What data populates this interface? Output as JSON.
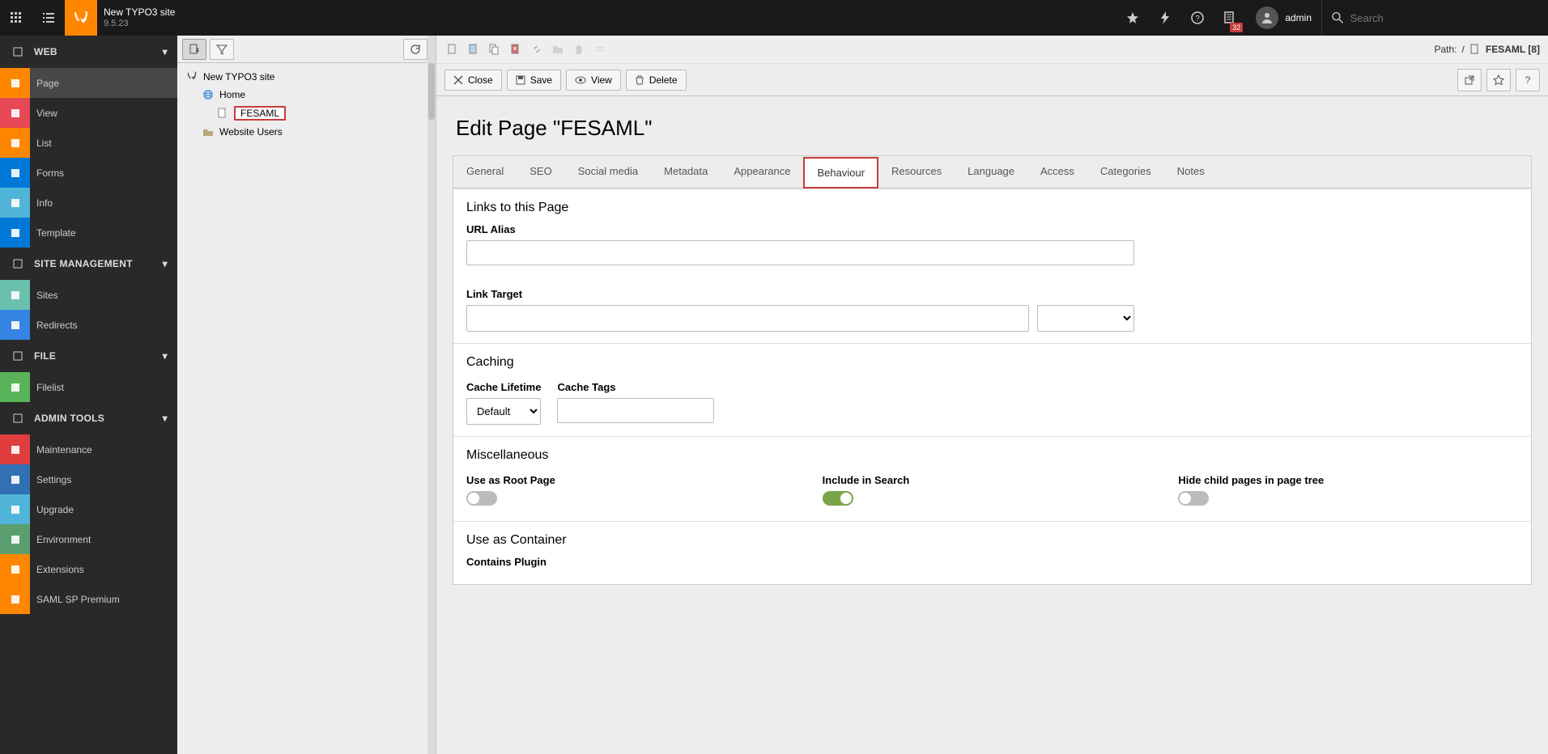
{
  "topbar": {
    "site_title": "New TYPO3 site",
    "site_version": "9.5.23",
    "badge": "32",
    "username": "admin",
    "search_placeholder": "Search"
  },
  "modmenu": {
    "groups": [
      {
        "label": "WEB",
        "items": [
          {
            "label": "Page",
            "color": "#ff8700",
            "active": true
          },
          {
            "label": "View",
            "color": "#e74856"
          },
          {
            "label": "List",
            "color": "#ff8700"
          },
          {
            "label": "Forms",
            "color": "#0078d7"
          },
          {
            "label": "Info",
            "color": "#4fb4d8"
          },
          {
            "label": "Template",
            "color": "#0078d7"
          }
        ]
      },
      {
        "label": "SITE MANAGEMENT",
        "items": [
          {
            "label": "Sites",
            "color": "#69c0ac"
          },
          {
            "label": "Redirects",
            "color": "#3584e4"
          }
        ]
      },
      {
        "label": "FILE",
        "items": [
          {
            "label": "Filelist",
            "color": "#59b359"
          }
        ]
      },
      {
        "label": "ADMIN TOOLS",
        "items": [
          {
            "label": "Maintenance",
            "color": "#e03e3e"
          },
          {
            "label": "Settings",
            "color": "#3070b3"
          },
          {
            "label": "Upgrade",
            "color": "#4fb4d8"
          },
          {
            "label": "Environment",
            "color": "#5a9e6f"
          },
          {
            "label": "Extensions",
            "color": "#ff8700"
          },
          {
            "label": "SAML SP Premium",
            "color": "#ff8700"
          }
        ]
      }
    ]
  },
  "tree": {
    "root": "New TYPO3 site",
    "nodes": [
      {
        "label": "Home",
        "indent": 1,
        "icon": "globe"
      },
      {
        "label": "FESAML",
        "indent": 2,
        "icon": "page",
        "selected": true
      },
      {
        "label": "Website Users",
        "indent": 1,
        "icon": "folder"
      }
    ]
  },
  "docheader": {
    "path_label": "Path:",
    "path_root": "/",
    "breadcrumb_page": "FESAML [8]",
    "buttons": {
      "close": "Close",
      "save": "Save",
      "view": "View",
      "delete": "Delete"
    }
  },
  "form": {
    "heading": "Edit Page \"FESAML\"",
    "tabs": [
      "General",
      "SEO",
      "Social media",
      "Metadata",
      "Appearance",
      "Behaviour",
      "Resources",
      "Language",
      "Access",
      "Categories",
      "Notes"
    ],
    "active_tab": "Behaviour",
    "sections": {
      "links": {
        "title": "Links to this Page",
        "url_alias_label": "URL Alias",
        "url_alias_value": "",
        "link_target_label": "Link Target",
        "link_target_value": "",
        "link_target_select": ""
      },
      "caching": {
        "title": "Caching",
        "lifetime_label": "Cache Lifetime",
        "lifetime_value": "Default",
        "tags_label": "Cache Tags",
        "tags_value": ""
      },
      "misc": {
        "title": "Miscellaneous",
        "root_label": "Use as Root Page",
        "root_value": false,
        "search_label": "Include in Search",
        "search_value": true,
        "hide_label": "Hide child pages in page tree",
        "hide_value": false
      },
      "container": {
        "title": "Use as Container",
        "plugin_label": "Contains Plugin"
      }
    }
  }
}
